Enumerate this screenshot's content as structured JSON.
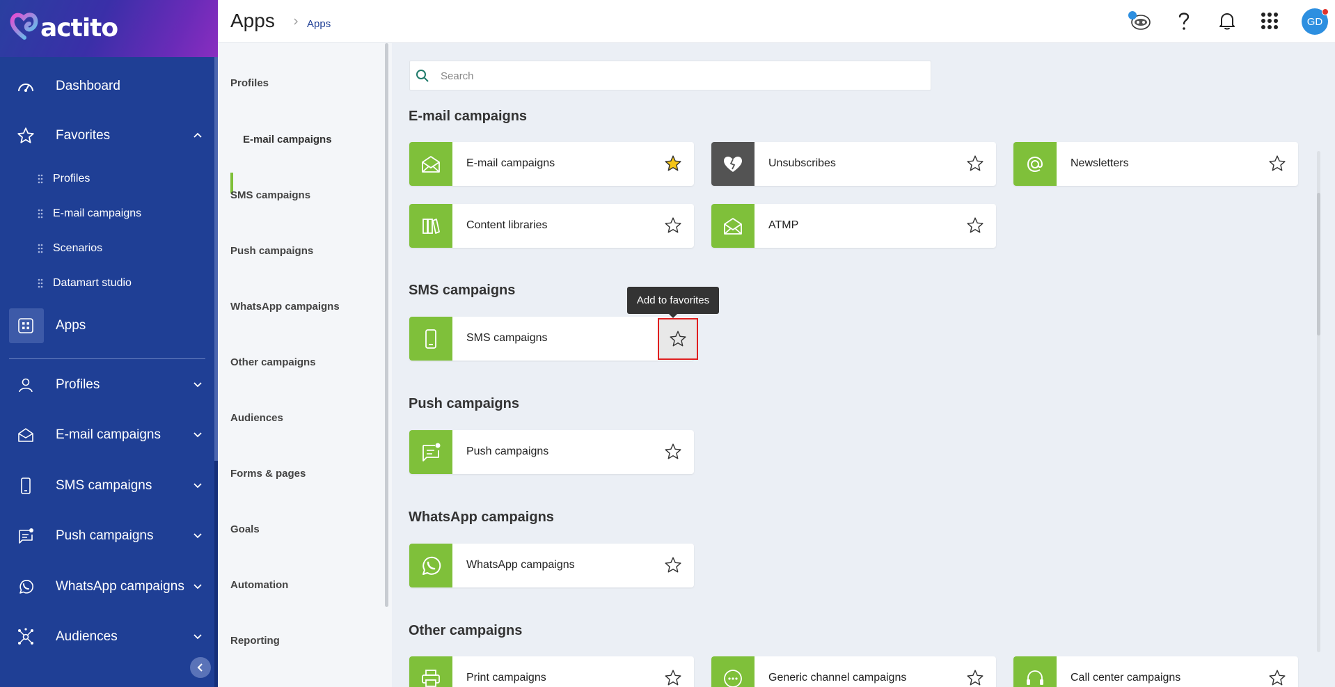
{
  "brand": {
    "name": "actito"
  },
  "nav": {
    "items": [
      {
        "label": "Dashboard",
        "icon": "gauge-icon"
      },
      {
        "label": "Favorites",
        "icon": "star-icon"
      },
      {
        "label": "Apps",
        "icon": "apps-grid-icon"
      },
      {
        "label": "Profiles",
        "icon": "user-icon"
      },
      {
        "label": "E-mail campaigns",
        "icon": "envelope-icon"
      },
      {
        "label": "SMS campaigns",
        "icon": "mobile-icon"
      },
      {
        "label": "Push campaigns",
        "icon": "push-message-icon"
      },
      {
        "label": "WhatsApp campaigns",
        "icon": "whatsapp-icon"
      },
      {
        "label": "Audiences",
        "icon": "network-icon"
      }
    ],
    "favorites": [
      "Profiles",
      "E-mail campaigns",
      "Scenarios",
      "Datamart studio"
    ]
  },
  "header": {
    "title": "Apps",
    "breadcrumb": "Apps",
    "avatar_initials": "GD",
    "avatar_color": "#2d8fe0"
  },
  "categories": [
    "Profiles",
    "E-mail campaigns",
    "SMS campaigns",
    "Push campaigns",
    "WhatsApp campaigns",
    "Other campaigns",
    "Audiences",
    "Forms & pages",
    "Goals",
    "Automation",
    "Reporting"
  ],
  "search": {
    "placeholder": "Search"
  },
  "sections": {
    "email": {
      "title": "E-mail campaigns",
      "apps": [
        {
          "label": "E-mail campaigns",
          "favorite": true
        },
        {
          "label": "Unsubscribes",
          "favorite": false
        },
        {
          "label": "Newsletters",
          "favorite": false
        },
        {
          "label": "Content libraries",
          "favorite": false
        },
        {
          "label": "ATMP",
          "favorite": false
        }
      ]
    },
    "sms": {
      "title": "SMS campaigns",
      "apps": [
        {
          "label": "SMS campaigns",
          "favorite": false
        }
      ]
    },
    "push": {
      "title": "Push campaigns",
      "apps": [
        {
          "label": "Push campaigns",
          "favorite": false
        }
      ]
    },
    "whatsapp": {
      "title": "WhatsApp campaigns",
      "apps": [
        {
          "label": "WhatsApp campaigns",
          "favorite": false
        }
      ]
    },
    "other": {
      "title": "Other campaigns",
      "apps": [
        {
          "label": "Print campaigns",
          "favorite": false
        },
        {
          "label": "Generic channel campaigns",
          "favorite": false
        },
        {
          "label": "Call center campaigns",
          "favorite": false
        }
      ]
    }
  },
  "tooltip": {
    "text": "Add to favorites"
  },
  "colors": {
    "nav": "#1f3f95",
    "accent": "#7fc03a",
    "favorite_star": "#f5c518"
  }
}
